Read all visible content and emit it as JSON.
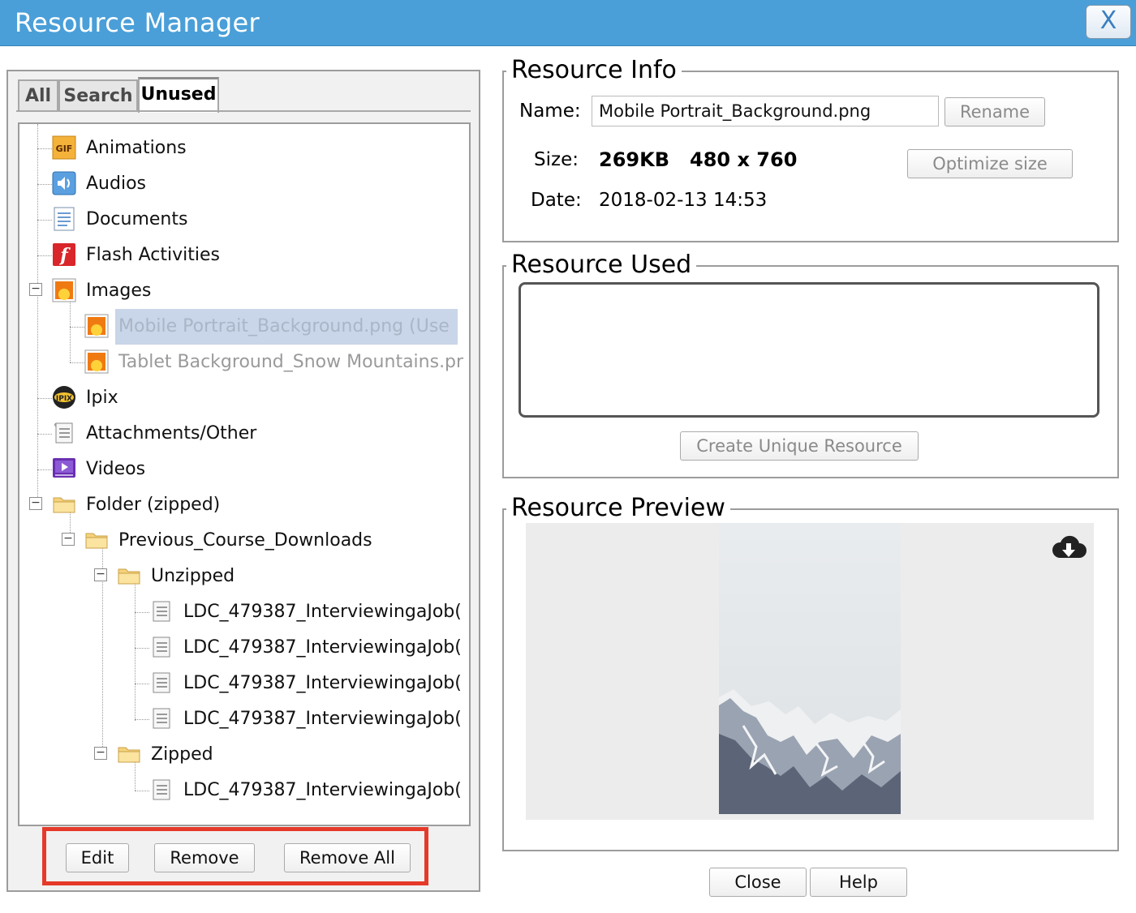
{
  "window": {
    "title": "Resource Manager",
    "close_glyph": "X"
  },
  "tabs": [
    {
      "label": "All",
      "active": false
    },
    {
      "label": "Search",
      "active": false
    },
    {
      "label": "Unused",
      "active": true
    }
  ],
  "tree": {
    "animations": "Animations",
    "audios": "Audios",
    "documents": "Documents",
    "flash": "Flash Activities",
    "images": "Images",
    "image_1": "Mobile Portrait_Background.png    (Use",
    "image_2": "Tablet Background_Snow Mountains.pr",
    "ipix": "Ipix",
    "attachments": "Attachments/Other",
    "videos": "Videos",
    "folder": "Folder (zipped)",
    "prev": "Previous_Course_Downloads",
    "unzipped": "Unzipped",
    "file_1": "LDC_479387_InterviewingaJob(",
    "file_2": "LDC_479387_InterviewingaJob(",
    "file_3": "LDC_479387_InterviewingaJob(",
    "file_4": "LDC_479387_InterviewingaJob(",
    "zipped": "Zipped",
    "file_5": "LDC_479387_InterviewingaJob("
  },
  "left_buttons": {
    "edit": "Edit",
    "remove": "Remove",
    "remove_all": "Remove All"
  },
  "info": {
    "legend": "Resource Info",
    "name_label": "Name:",
    "name_value": "Mobile Portrait_Background.png",
    "rename": "Rename",
    "size_label": "Size:",
    "size_value": "269KB",
    "dimensions": "480 x 760",
    "optimize": "Optimize size",
    "date_label": "Date:",
    "date_value": "2018-02-13 14:53"
  },
  "used": {
    "legend": "Resource Used",
    "create_unique": "Create Unique Resource"
  },
  "preview": {
    "legend": "Resource Preview"
  },
  "footer": {
    "close": "Close",
    "help": "Help"
  },
  "colors": {
    "titlebar": "#4a9fd8",
    "highlight": "#e53a2a",
    "selection": "#c9d5e8"
  },
  "icons": [
    "gif-icon",
    "audio-icon",
    "document-icon",
    "flash-icon",
    "image-icon",
    "ipix-icon",
    "attachment-icon",
    "video-icon",
    "folder-icon",
    "cloud-download-icon"
  ]
}
